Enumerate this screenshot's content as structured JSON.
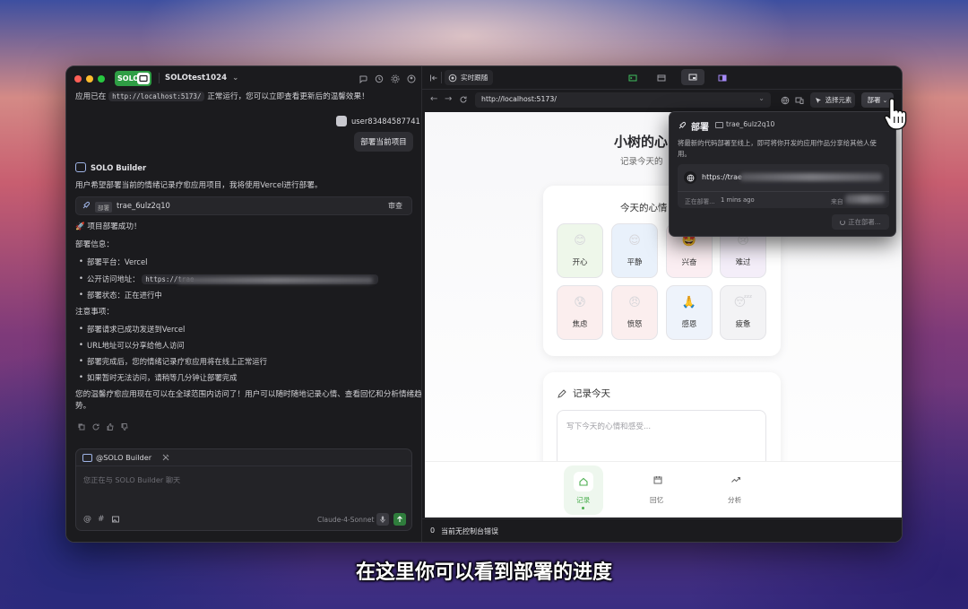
{
  "titlebar": {
    "solo_label": "SOLO",
    "project": "SOLOtest1024",
    "project_chevron": "⌄"
  },
  "chat": {
    "top_line_prefix": "应用已在",
    "top_line_url": "http://localhost:5173/",
    "top_line_suffix": "正常运行，您可以立即查看更新后的温馨效果！",
    "user_name": "user83484587741",
    "user_message": "部署当前项目",
    "assistant_name": "SOLO Builder",
    "intro": "用户希望部署当前的情绪记录疗愈应用项目，我将使用Vercel进行部署。",
    "deploy_card": {
      "tag": "部署",
      "id": "trae_6ulz2q10",
      "action": "审查"
    },
    "success": "🚀 项目部署成功！",
    "info_heading": "部署信息：",
    "info_items": {
      "platform": "部署平台：Vercel",
      "url_label": "公开访问地址：",
      "url_value": "https://trae",
      "status": "部署状态：正在进行中"
    },
    "notes_heading": "注意事项：",
    "notes": [
      "部署请求已成功发送到Vercel",
      "URL地址可以分享给他人访问",
      "部署完成后，您的情绪记录疗愈应用将在线上正常运行",
      "如果暂时无法访问，请稍等几分钟让部署完成"
    ],
    "closing_1": "您的温馨疗愈应用现在可以在全球范围内访问了！用户可以随时随地记录心情、查看回忆和分析情绪趋",
    "closing_2": "势。",
    "composer": {
      "mention": "@SOLO Builder",
      "placeholder": "您正在与 SOLO Builder 聊天",
      "model": "Claude-4-Sonnet"
    }
  },
  "browser": {
    "tab_live": "实时跟随",
    "address": "http://localhost:5173/",
    "select_element": "选择元素",
    "deploy_button": "部署",
    "status_count": "0",
    "status_text": "当前无控制台错误"
  },
  "app": {
    "title": "小树的心",
    "subtitle": "记录今天的",
    "mood_card_title": "今天的心情",
    "moods": [
      {
        "emoji": "😊",
        "label": "开心",
        "color": "#eef7ea"
      },
      {
        "emoji": "😌",
        "label": "平静",
        "color": "#e9f1fb"
      },
      {
        "emoji": "🤩",
        "label": "兴奋",
        "color": "#fbeef2"
      },
      {
        "emoji": "😢",
        "label": "难过",
        "color": "#f4eef9"
      },
      {
        "emoji": "😰",
        "label": "焦虑",
        "color": "#fbeeee"
      },
      {
        "emoji": "😠",
        "label": "愤怒",
        "color": "#fbeeee"
      },
      {
        "emoji": "🙏",
        "label": "感恩",
        "color": "#eef3fb"
      },
      {
        "emoji": "😴",
        "label": "疲惫",
        "color": "#f3f3f5"
      }
    ],
    "record_title": "记录今天",
    "record_placeholder": "写下今天的心情和感受...",
    "nav": [
      "记录",
      "回忆",
      "分析"
    ]
  },
  "popup": {
    "title": "部署",
    "id": "trae_6ulz2q10",
    "description_1": "将最新的代码部署至线上，即可将你开发的应用作品分享给其他人使",
    "description_2": "用。",
    "url_prefix": "https://trae",
    "meta_status": "正在部署...",
    "meta_time": "1 mins ago",
    "meta_from": "来自",
    "deploying_button": "正在部署..."
  },
  "subtitle": "在这里你可以看到部署的进度",
  "colors": {
    "accent": "#2f9e45",
    "app_green": "#4caf50",
    "window_bg": "#1c1c1f"
  }
}
